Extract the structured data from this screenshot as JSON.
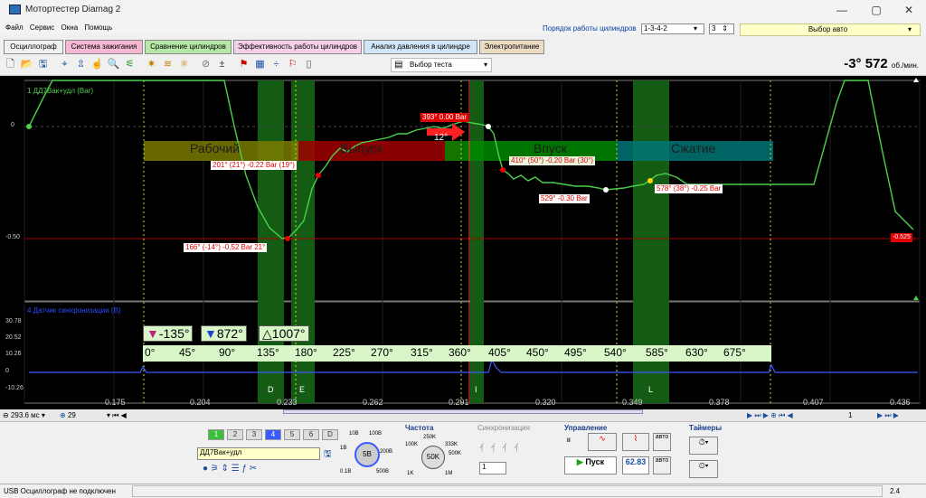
{
  "window": {
    "title": "Мотортестер Diamag 2",
    "min": "—",
    "max": "▢",
    "close": "✕"
  },
  "menu": [
    "Файл",
    "Сервис",
    "Окна",
    "Помощь"
  ],
  "header": {
    "order_label": "Порядок работы цилиндров",
    "order_value": "1-3-4-2",
    "cyl_count": "3",
    "auto_label": "Выбор авто"
  },
  "tabs": [
    {
      "label": "Осциллограф",
      "bg": "#ffffff"
    },
    {
      "label": "Система зажигания",
      "bg": "#f5b8d2"
    },
    {
      "label": "Сравнение цилиндров",
      "bg": "#b5e8a6"
    },
    {
      "label": "Эффективность работы цилиндров",
      "bg": "#f5d0e8"
    },
    {
      "label": "Анализ давления в цилиндре",
      "bg": "#d0e6f8"
    },
    {
      "label": "Электропитание",
      "bg": "#ecdcc4"
    }
  ],
  "toolbar": {
    "test_select": "Выбор теста",
    "rpm_value": "-3° 572",
    "rpm_unit": "об./мин."
  },
  "scope": {
    "ch1_label": "1 ДД7Вак+удл (Bar)",
    "ch2_label": "4 Датчик синхронизации (В)",
    "y1_ticks": [
      {
        "label": "0",
        "v": 0
      },
      {
        "label": "-0.50",
        "v": -0.5
      }
    ],
    "y1_right_value": "-0.525",
    "y2_ticks": [
      "30.78",
      "20.52",
      "10.26",
      "0",
      "-10.26"
    ],
    "phases": [
      {
        "label": "Рабочий",
        "color": "#7a7a00"
      },
      {
        "label": "Выпуск",
        "color": "#a00000"
      },
      {
        "label": "Впуск",
        "color": "#008800"
      },
      {
        "label": "Сжатие",
        "color": "#007575"
      }
    ],
    "annotations": [
      {
        "text": "393° 0.00 Bar",
        "style": "red2"
      },
      {
        "text": "12°",
        "style": "red2"
      },
      {
        "text": "201° (21°) -0.22 Bar (19°)",
        "style": "red"
      },
      {
        "text": "410° (50°) -0.20 Bar (30°)",
        "style": "green"
      },
      {
        "text": "529° -0.30 Bar",
        "style": "red"
      },
      {
        "text": "578° (38°) -0.25 Bar",
        "style": "red"
      },
      {
        "text": "166° (-14°) -0.52 Bar 21°",
        "style": "red"
      }
    ],
    "markers": {
      "m1": "-135°",
      "m2": "872°",
      "delta": "1007°"
    },
    "angle_scale": [
      "0°",
      "45°",
      "90°",
      "135°",
      "180°",
      "225°",
      "270°",
      "315°",
      "360°",
      "405°",
      "450°",
      "495°",
      "540°",
      "585°",
      "630°",
      "675°"
    ],
    "cyl_letters": [
      "D",
      "E",
      "I",
      "L"
    ],
    "x_ticks": [
      "0.175",
      "0.204",
      "0.233",
      "0.262",
      "0.291",
      "0.320",
      "0.349",
      "0.378",
      "0.407",
      "0.436"
    ]
  },
  "bottom": {
    "timebase": "293.6 мс",
    "zoom": "29",
    "page": "1"
  },
  "controls": {
    "channels": [
      "1",
      "2",
      "3",
      "4",
      "5",
      "6",
      "D"
    ],
    "channel_name": "ДД7Вак+удл",
    "range_labels": [
      "10В",
      "100В",
      "1В",
      "5В",
      "200В",
      "0.1В",
      "500В"
    ],
    "freq_title": "Частота",
    "freq_labels": [
      "250K",
      "100K",
      "333K",
      "500K",
      "50K",
      "1K",
      "1M"
    ],
    "sync_title": "Синхронизация",
    "sync_value": "1",
    "control_title": "Управление",
    "start_label": "Пуск",
    "rate": "62.83",
    "timers_title": "Таймеры",
    "auto1": "авто",
    "auto2": "авто"
  },
  "status": {
    "text": "USB Осциллограф не подключен",
    "right": "2.4"
  }
}
